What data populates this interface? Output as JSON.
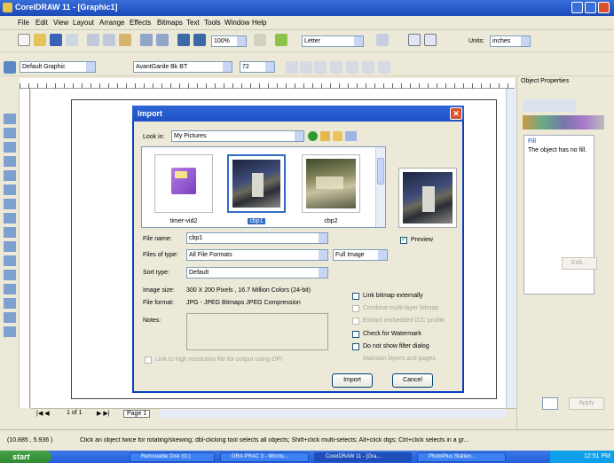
{
  "window": {
    "title": "CorelDRAW 11 - [Graphic1]"
  },
  "menu": [
    "File",
    "Edit",
    "View",
    "Layout",
    "Arrange",
    "Effects",
    "Bitmaps",
    "Text",
    "Tools",
    "Window",
    "Help"
  ],
  "toolbar1": {
    "zoom": "100%",
    "paper": "Letter",
    "units_label": "Units:",
    "units": "inches"
  },
  "toolbar2": {
    "style": "Default Graphic",
    "font": "AvantGarde Bk BT",
    "size": "72"
  },
  "docker": {
    "title": "Object Properties",
    "fill_label": "Fill",
    "fill_text": "The object has no fill.",
    "edit_label": "Edit...",
    "apply_label": "Apply"
  },
  "pagebar": {
    "pages": "1 of 1",
    "page_tab": "Page 1"
  },
  "status": {
    "coords": "(10.885 , 5.936 )",
    "hint": "Click an object twice for rotating/skewing; dbl-clicking tool selects all objects; Shift+click multi-selects; Alt+click digs; Ctrl+click selects in a gr..."
  },
  "taskbar": {
    "start": "start",
    "tasks": [
      "Removable Disk (G:)",
      "GRA PRAC 3 - Micros...",
      "CorelDRAW 11 - [Gra...",
      "PhotoPlus Station..."
    ],
    "time": "12:51 PM"
  },
  "dialog": {
    "title": "Import",
    "look_in_label": "Look in:",
    "look_in_value": "My Pictures",
    "thumbs": [
      {
        "caption": "timer-vid2",
        "kind": "folder",
        "selected": false
      },
      {
        "caption": "cbp1",
        "kind": "photo",
        "selected": true
      },
      {
        "caption": "cbp2",
        "kind": "photo2",
        "selected": false
      }
    ],
    "filename_label": "File name:",
    "filename_value": "cbp1",
    "filetype_label": "Files of type:",
    "filetype_value": "All File Formats",
    "full_image": "Full Image",
    "sorttype_label": "Sort type:",
    "sorttype_value": "Default",
    "preview_label": "Preview",
    "image_size_label": "Image size:",
    "image_size_value": "300 X 200 Pixels , 16.7 Million Colors (24-bit)",
    "file_format_label": "File format:",
    "file_format_value": "JPG - JPEG Bitmaps JPEG Compression",
    "notes_label": "Notes:",
    "options": [
      {
        "label": "Link bitmap externally",
        "checked": false,
        "enabled": true
      },
      {
        "label": "Combine multi-layer bitmap",
        "checked": false,
        "enabled": false
      },
      {
        "label": "Extract embedded ICC profile",
        "checked": false,
        "enabled": false
      },
      {
        "label": "Check for Watermark",
        "checked": false,
        "enabled": true
      },
      {
        "label": "Do not show filter dialog",
        "checked": false,
        "enabled": true
      },
      {
        "label": "Maintain layers and pages",
        "checked": false,
        "enabled": false
      }
    ],
    "link_hires": "Link to high resolution file for output using OPI",
    "import_label": "Import",
    "cancel_label": "Cancel"
  }
}
